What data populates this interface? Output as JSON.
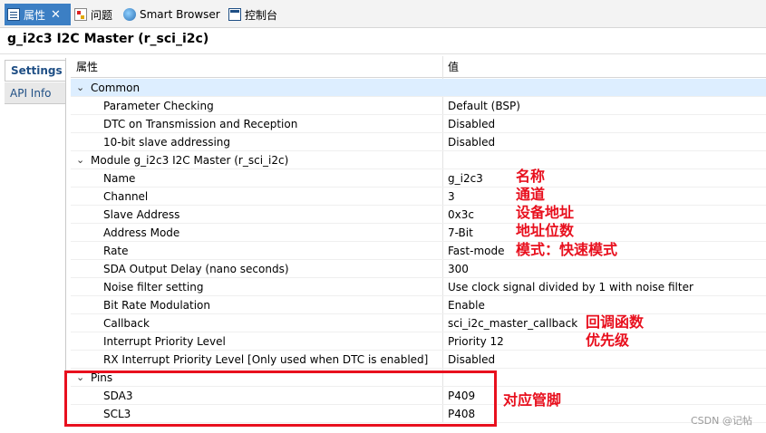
{
  "tabs": [
    {
      "label": "属性",
      "icon": "properties-icon",
      "active": true
    },
    {
      "label": "问题",
      "icon": "problems-icon",
      "active": false
    },
    {
      "label": "Smart Browser",
      "icon": "browser-globe-icon",
      "active": false
    },
    {
      "label": "控制台",
      "icon": "console-icon",
      "active": false
    }
  ],
  "close_glyph": "✕",
  "title": "g_i2c3 I2C Master (r_sci_i2c)",
  "side_tabs": [
    {
      "label": "Settings",
      "selected": true
    },
    {
      "label": "API Info",
      "selected": false
    }
  ],
  "table": {
    "headers": {
      "property": "属性",
      "value": "值"
    },
    "rows": [
      {
        "key": "Common",
        "value": "",
        "category": true,
        "selected": true
      },
      {
        "key": "Parameter Checking",
        "value": "Default (BSP)"
      },
      {
        "key": "DTC on Transmission and Reception",
        "value": "Disabled"
      },
      {
        "key": "10-bit slave addressing",
        "value": "Disabled"
      },
      {
        "key": "Module g_i2c3 I2C Master (r_sci_i2c)",
        "value": "",
        "category": true
      },
      {
        "key": "Name",
        "value": "g_i2c3"
      },
      {
        "key": "Channel",
        "value": "3"
      },
      {
        "key": "Slave Address",
        "value": "0x3c"
      },
      {
        "key": "Address Mode",
        "value": "7-Bit"
      },
      {
        "key": "Rate",
        "value": "Fast-mode"
      },
      {
        "key": "SDA Output Delay (nano seconds)",
        "value": "300"
      },
      {
        "key": "Noise filter setting",
        "value": "Use clock signal divided by 1 with noise filter"
      },
      {
        "key": "Bit Rate Modulation",
        "value": "Enable"
      },
      {
        "key": "Callback",
        "value": "sci_i2c_master_callback"
      },
      {
        "key": "Interrupt Priority Level",
        "value": "Priority 12"
      },
      {
        "key": "RX Interrupt Priority Level [Only used when DTC is enabled]",
        "value": "Disabled"
      },
      {
        "key": "Pins",
        "value": "",
        "category": true
      },
      {
        "key": "SDA3",
        "value": "P409"
      },
      {
        "key": "SCL3",
        "value": "P408"
      }
    ]
  },
  "annotations": {
    "name": "名称",
    "channel": "通道",
    "slave_address": "设备地址",
    "address_mode": "地址位数",
    "rate": "模式：快速模式",
    "callback": "回调函数",
    "priority": "优先级",
    "pins": "对应管脚"
  },
  "watermark": "CSDN @记帖",
  "colors": {
    "accent_tab": "#3c7fc4",
    "annotation_red": "#e8101e",
    "selected_row": "#ddeeff"
  }
}
